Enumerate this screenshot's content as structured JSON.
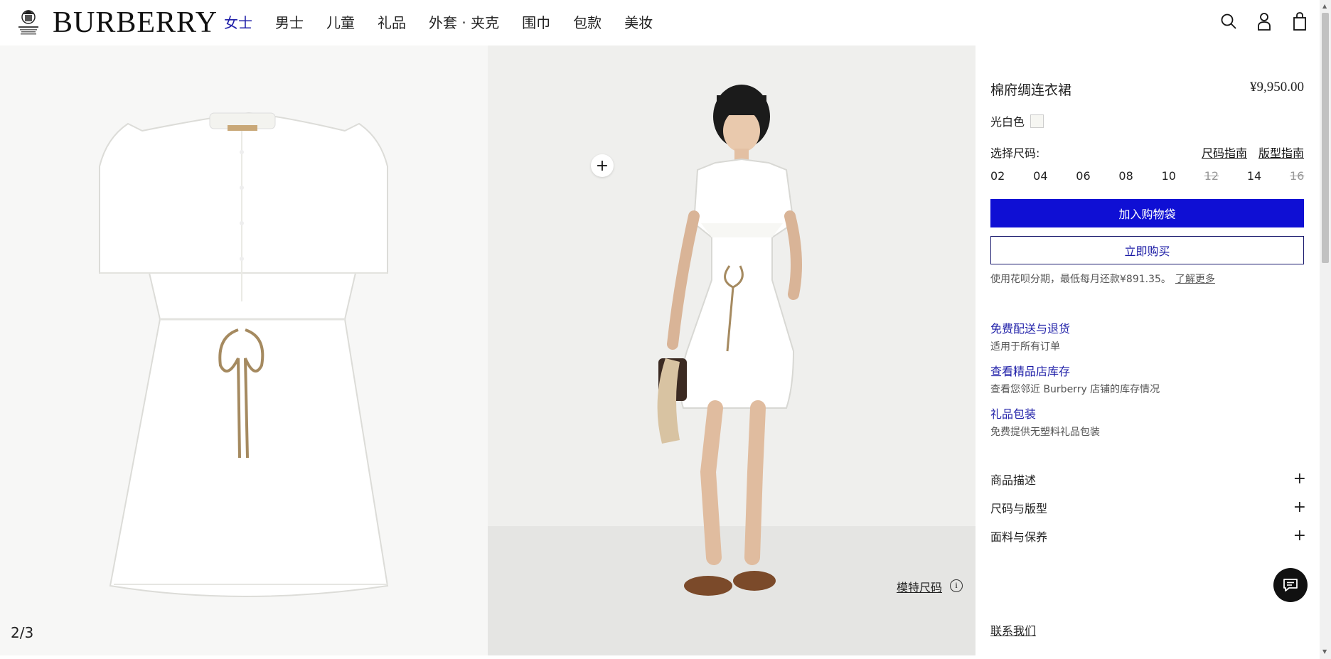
{
  "header": {
    "logo_text": "BURBERRY",
    "nav": [
      {
        "label": "女士",
        "active": true
      },
      {
        "label": "男士"
      },
      {
        "label": "儿童"
      },
      {
        "label": "礼品"
      },
      {
        "label": "外套 · 夹克"
      },
      {
        "label": "围巾"
      },
      {
        "label": "包款"
      },
      {
        "label": "美妆"
      }
    ],
    "icons": [
      "search-icon",
      "account-icon",
      "shopping-bag-icon"
    ],
    "accent_color": "#1f1fa8"
  },
  "gallery": {
    "counter": "2/3",
    "model_size_label": "模特尺码",
    "zoom_icon": "plus-icon"
  },
  "product": {
    "title": "棉府绸连衣裙",
    "price": "¥9,950.00",
    "color_name": "光白色",
    "size_label": "选择尺码:",
    "size_guide": "尺码指南",
    "fit_guide": "版型指南",
    "sizes": [
      {
        "label": "02",
        "available": true
      },
      {
        "label": "04",
        "available": true
      },
      {
        "label": "06",
        "available": true
      },
      {
        "label": "08",
        "available": true
      },
      {
        "label": "10",
        "available": true
      },
      {
        "label": "12",
        "available": false
      },
      {
        "label": "14",
        "available": true
      },
      {
        "label": "16",
        "available": false
      }
    ],
    "add_to_bag": "加入购物袋",
    "buy_now": "立即购买",
    "installment_text": "使用花呗分期，最低每月还款¥891.35。",
    "learn_more": "了解更多",
    "primary_button_color": "#0f0fd4"
  },
  "services": [
    {
      "title": "免费配送与退货",
      "sub": "适用于所有订单"
    },
    {
      "title": "查看精品店库存",
      "sub": "查看您邻近 Burberry 店铺的库存情况"
    },
    {
      "title": "礼品包装",
      "sub": "免费提供无塑料礼品包装"
    }
  ],
  "accordion": [
    {
      "label": "商品描述"
    },
    {
      "label": "尺码与版型"
    },
    {
      "label": "面料与保养"
    }
  ],
  "contact": "联系我们",
  "chat_icon": "chat-icon"
}
